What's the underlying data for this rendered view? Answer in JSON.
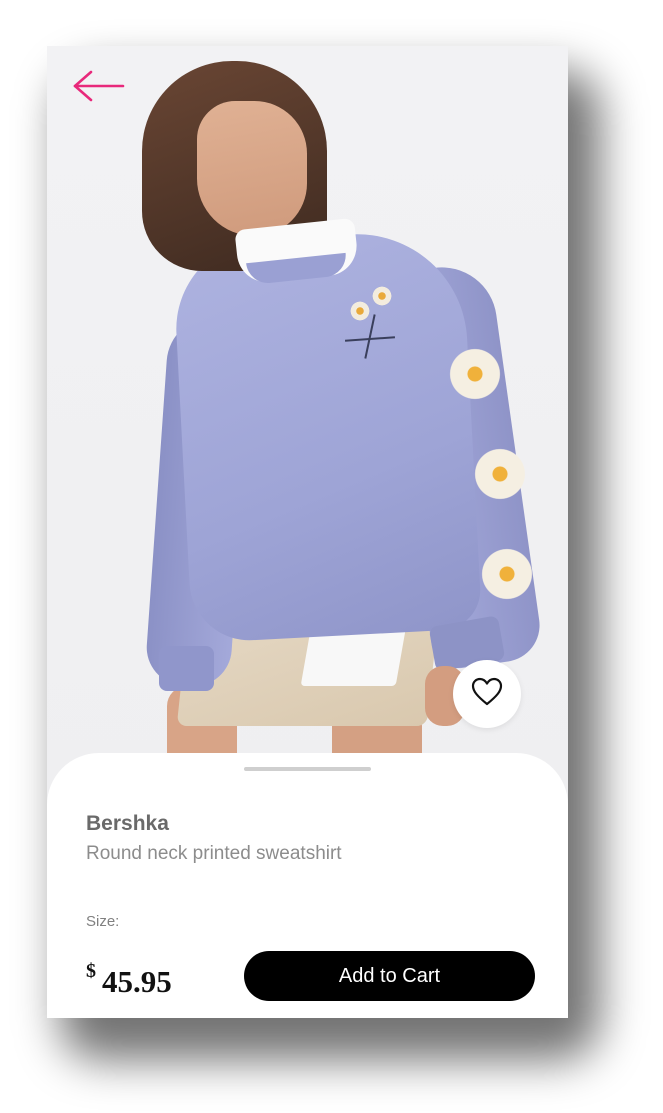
{
  "product": {
    "brand": "Bershka",
    "name": "Round neck printed sweatshirt",
    "size_label": "Size:",
    "currency_symbol": "$",
    "price": "45.95",
    "image_name": "product-photo-lavender-sweatshirt"
  },
  "actions": {
    "add_to_cart_label": "Add to Cart",
    "back_icon": "arrow-left-icon",
    "favorite_icon": "heart-outline-icon"
  },
  "colors": {
    "accent": "#e8297b",
    "button": "#000000",
    "button_text": "#ffffff",
    "sheet_background": "#ffffff",
    "grabber": "#cfcfcf"
  }
}
